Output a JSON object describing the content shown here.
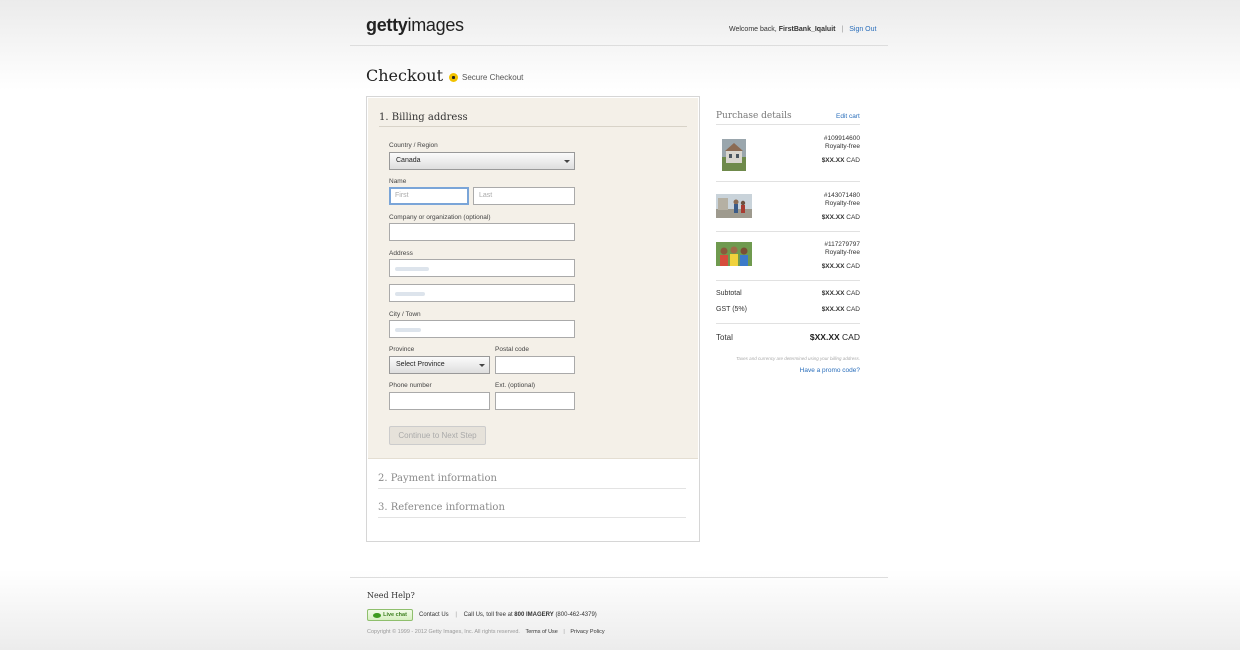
{
  "header": {
    "logo_bold": "getty",
    "logo_rest": "images",
    "welcome_prefix": "Welcome back,",
    "username": "FirstBank_Iqaluit",
    "separator": "|",
    "sign_out": "Sign Out"
  },
  "page": {
    "title": "Checkout",
    "secure_label": "Secure Checkout"
  },
  "billing": {
    "section_title": "1. Billing address",
    "country_label": "Country / Region",
    "country_value": "Canada",
    "name_label": "Name",
    "first_placeholder": "First",
    "last_placeholder": "Last",
    "company_label": "Company or organization (optional)",
    "address_label": "Address",
    "city_label": "City / Town",
    "province_label": "Province",
    "province_value": "Select Province",
    "postal_label": "Postal code",
    "phone_label": "Phone number",
    "ext_label": "Ext. (optional)",
    "continue_button": "Continue to Next Step"
  },
  "sections": {
    "payment": "2. Payment information",
    "reference": "3. Reference information"
  },
  "purchase": {
    "title": "Purchase details",
    "edit_cart": "Edit cart",
    "items": [
      {
        "id": "#109914600",
        "license": "Royalty-free",
        "price": "$XX.XX",
        "currency": "CAD"
      },
      {
        "id": "#143071480",
        "license": "Royalty-free",
        "price": "$XX.XX",
        "currency": "CAD"
      },
      {
        "id": "#117279797",
        "license": "Royalty-free",
        "price": "$XX.XX",
        "currency": "CAD"
      }
    ],
    "subtotal_label": "Subtotal",
    "subtotal_value": "$XX.XX",
    "gst_label": "GST (5%)",
    "gst_value": "$XX.XX",
    "currency": "CAD",
    "total_label": "Total",
    "total_value": "$XX.XX",
    "tax_note": "Taxes and currency are determined using your billing address.",
    "promo_link": "Have a promo code?"
  },
  "footer": {
    "need_help": "Need Help?",
    "live_chat": "Live chat",
    "contact_us": "Contact Us",
    "separator": "|",
    "call_prefix": "Call Us, toll free at",
    "call_number_name": "800 IMAGERY",
    "call_number": "(800-462-4379)",
    "copyright": "Copyright © 1999 - 2012 Getty Images, Inc. All rights reserved.",
    "terms": "Terms of Use",
    "privacy": "Privacy Policy"
  },
  "colors": {
    "link": "#2a6ebb",
    "panel_bg": "#f4f0e8",
    "lock_yellow": "#f2c200",
    "chat_green": "#3d9b1e"
  }
}
